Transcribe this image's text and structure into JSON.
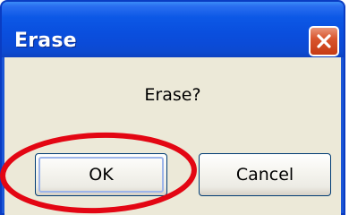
{
  "dialog": {
    "title": "Erase",
    "message": "Erase?",
    "ok_label": "OK",
    "cancel_label": "Cancel",
    "close_icon": "close-icon"
  },
  "annotation": {
    "color": "#e30613"
  },
  "colors": {
    "titlebar": "#0c58e6",
    "client": "#ece9d8",
    "close_button": "#d9562e"
  }
}
